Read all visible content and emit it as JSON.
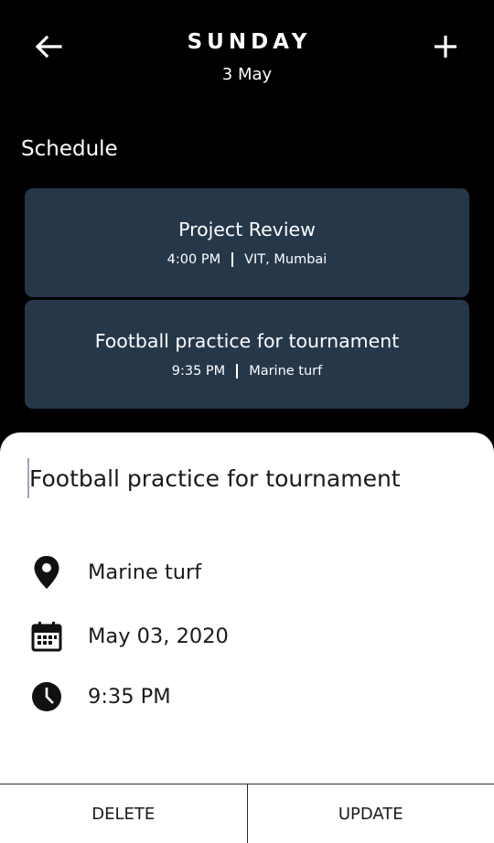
{
  "header": {
    "day": "SUNDAY",
    "date": "3 May",
    "back_icon": "arrow-left-icon",
    "add_icon": "plus-icon"
  },
  "section": {
    "title": "Schedule"
  },
  "events": [
    {
      "title": "Project Review",
      "time": "4:00 PM",
      "location": "VIT, Mumbai"
    },
    {
      "title": "Football practice for tournament",
      "time": "9:35 PM",
      "location": "Marine turf"
    }
  ],
  "detail": {
    "title_value": "Football practice for tournament",
    "location": "Marine turf",
    "date": "May 03, 2020",
    "time": "9:35 PM",
    "location_icon": "location-pin-icon",
    "date_icon": "calendar-icon",
    "time_icon": "clock-icon"
  },
  "actions": {
    "delete_label": "DELETE",
    "update_label": "UPDATE"
  },
  "colors": {
    "background": "#000000",
    "card": "#26374a",
    "sheet": "#ffffff"
  }
}
